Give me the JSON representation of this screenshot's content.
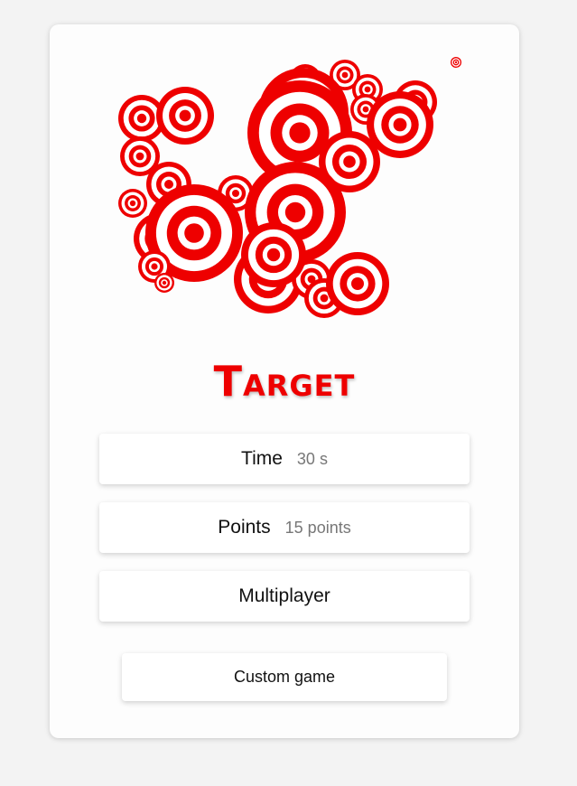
{
  "game": {
    "title": "Target",
    "accent_color": "#ee0000",
    "target_icon": "bullseye-target"
  },
  "menu": {
    "time": {
      "label": "Time",
      "value": "30 s"
    },
    "points": {
      "label": "Points",
      "value": "15 points"
    },
    "multiplayer": {
      "label": "Multiplayer"
    },
    "custom": {
      "label": "Custom game"
    }
  }
}
